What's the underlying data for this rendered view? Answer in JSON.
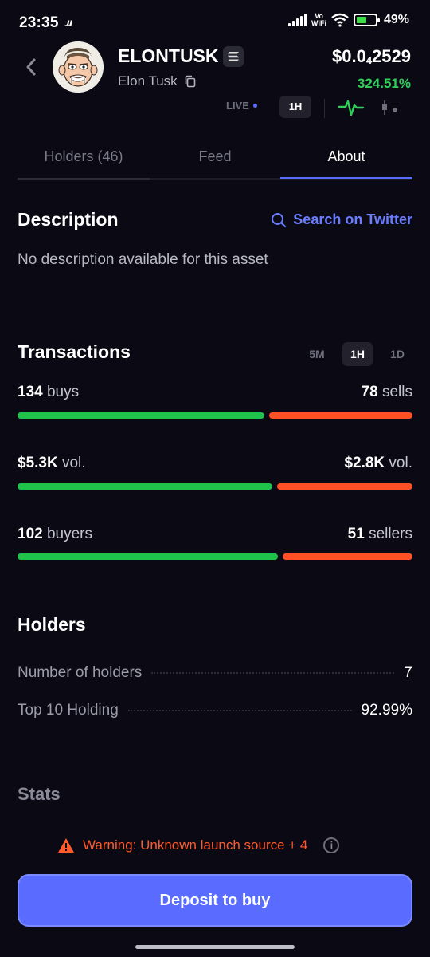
{
  "status_bar": {
    "time": "23:35",
    "app_logo": "ɹɹ",
    "vowifi_top": "Vo",
    "vowifi_bottom": "WiFi",
    "battery": "49%"
  },
  "header": {
    "coin_name": "ELONTUSK",
    "coin_subtitle": "Elon Tusk",
    "price_prefix": "$0.0",
    "price_subscript": "4",
    "price_suffix": "2529",
    "change": "324.51%",
    "icons": [
      "back-chevron-icon",
      "solana-chain-icon",
      "copy-icon"
    ]
  },
  "chart_controls": {
    "live_label": "LIVE",
    "timeframe": "1H",
    "icons": [
      "line-chart-icon",
      "candlestick-chart-icon"
    ]
  },
  "tabs": [
    {
      "label": "Holders (46)",
      "active": false
    },
    {
      "label": "Feed",
      "active": false
    },
    {
      "label": "About",
      "active": true
    }
  ],
  "description": {
    "title": "Description",
    "search_label": "Search on Twitter",
    "text": "No description available for this asset"
  },
  "transactions": {
    "title": "Transactions",
    "ranges": [
      {
        "label": "5M",
        "active": false
      },
      {
        "label": "1H",
        "active": true
      },
      {
        "label": "1D",
        "active": false
      }
    ],
    "rows": [
      {
        "left_num": "134",
        "left_unit": " buys",
        "right_num": "78",
        "right_unit": " sells",
        "left_share": 0.632
      },
      {
        "left_num": "$5.3K",
        "left_unit": " vol.",
        "right_num": "$2.8K",
        "right_unit": " vol.",
        "left_share": 0.654
      },
      {
        "left_num": "102",
        "left_unit": " buyers",
        "right_num": "51",
        "right_unit": " sellers",
        "left_share": 0.667
      }
    ]
  },
  "holders": {
    "title": "Holders",
    "rows": [
      {
        "label": "Number of holders",
        "value": "7"
      },
      {
        "label": "Top 10 Holding",
        "value": "92.99%"
      }
    ]
  },
  "stats": {
    "title": "Stats"
  },
  "warning": {
    "text": "Warning: Unknown launch source + 4",
    "info": "i"
  },
  "cta": {
    "label": "Deposit to buy"
  },
  "colors": {
    "accent": "#5a6cff",
    "buy": "#1fc24a",
    "sell": "#ff5026",
    "positive_change": "#2fd05a",
    "warning": "#ff5a2c"
  }
}
